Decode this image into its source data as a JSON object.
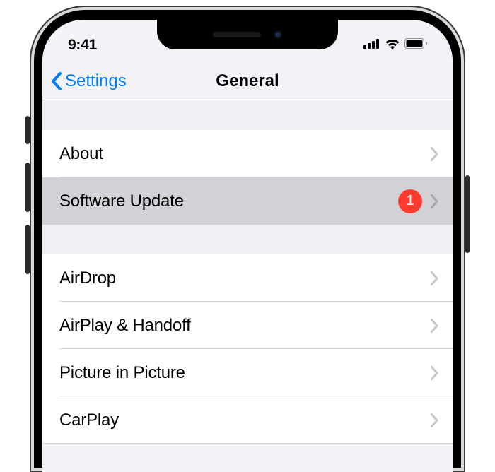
{
  "status": {
    "time": "9:41"
  },
  "nav": {
    "back_label": "Settings",
    "title": "General"
  },
  "groups": [
    {
      "rows": [
        {
          "label": "About",
          "badge": null,
          "selected": false
        },
        {
          "label": "Software Update",
          "badge": "1",
          "selected": true
        }
      ]
    },
    {
      "rows": [
        {
          "label": "AirDrop",
          "badge": null,
          "selected": false
        },
        {
          "label": "AirPlay & Handoff",
          "badge": null,
          "selected": false
        },
        {
          "label": "Picture in Picture",
          "badge": null,
          "selected": false
        },
        {
          "label": "CarPlay",
          "badge": null,
          "selected": false
        }
      ]
    }
  ]
}
